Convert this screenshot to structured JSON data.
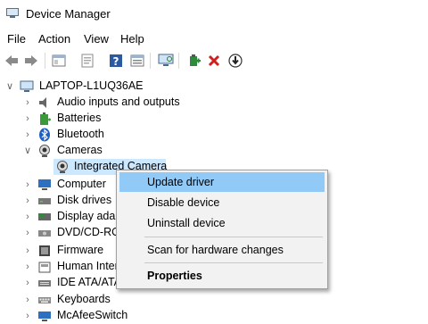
{
  "window": {
    "title": "Device Manager"
  },
  "menu": [
    "File",
    "Action",
    "View",
    "Help"
  ],
  "toolbar_icons": [
    "back-icon",
    "forward-icon",
    "properties-icon",
    "update-icon",
    "help-icon",
    "view-icon",
    "scan-icon",
    "add-driver-icon",
    "remove-icon",
    "download-icon"
  ],
  "tree": {
    "root": "LAPTOP-L1UQ36AE",
    "items": [
      {
        "label": "Audio inputs and outputs",
        "icon": "speaker-icon"
      },
      {
        "label": "Batteries",
        "icon": "battery-icon"
      },
      {
        "label": "Bluetooth",
        "icon": "bluetooth-icon"
      },
      {
        "label": "Cameras",
        "icon": "camera-icon"
      },
      {
        "label": "Integrated Camera",
        "icon": "camera-icon"
      },
      {
        "label": "Computer",
        "icon": "monitor-icon"
      },
      {
        "label": "Disk drives",
        "icon": "disk-icon"
      },
      {
        "label": "Display adap",
        "icon": "display-icon"
      },
      {
        "label": "DVD/CD-RO",
        "icon": "dvd-icon"
      },
      {
        "label": "Firmware",
        "icon": "firmware-icon"
      },
      {
        "label": "Human Inter",
        "icon": "hid-icon"
      },
      {
        "label": "IDE ATA/ATAP",
        "icon": "ide-icon"
      },
      {
        "label": "Keyboards",
        "icon": "keyboard-icon"
      },
      {
        "label": "McAfeeSwitch",
        "icon": "network-icon"
      }
    ]
  },
  "context_menu": {
    "items": [
      "Update driver",
      "Disable device",
      "Uninstall device",
      "Scan for hardware changes",
      "Properties"
    ],
    "highlighted": "Update driver"
  },
  "colors": {
    "selection": "#cce8ff",
    "menu_highlight": "#91c9f7",
    "menu_bg": "#f2f2f2"
  }
}
